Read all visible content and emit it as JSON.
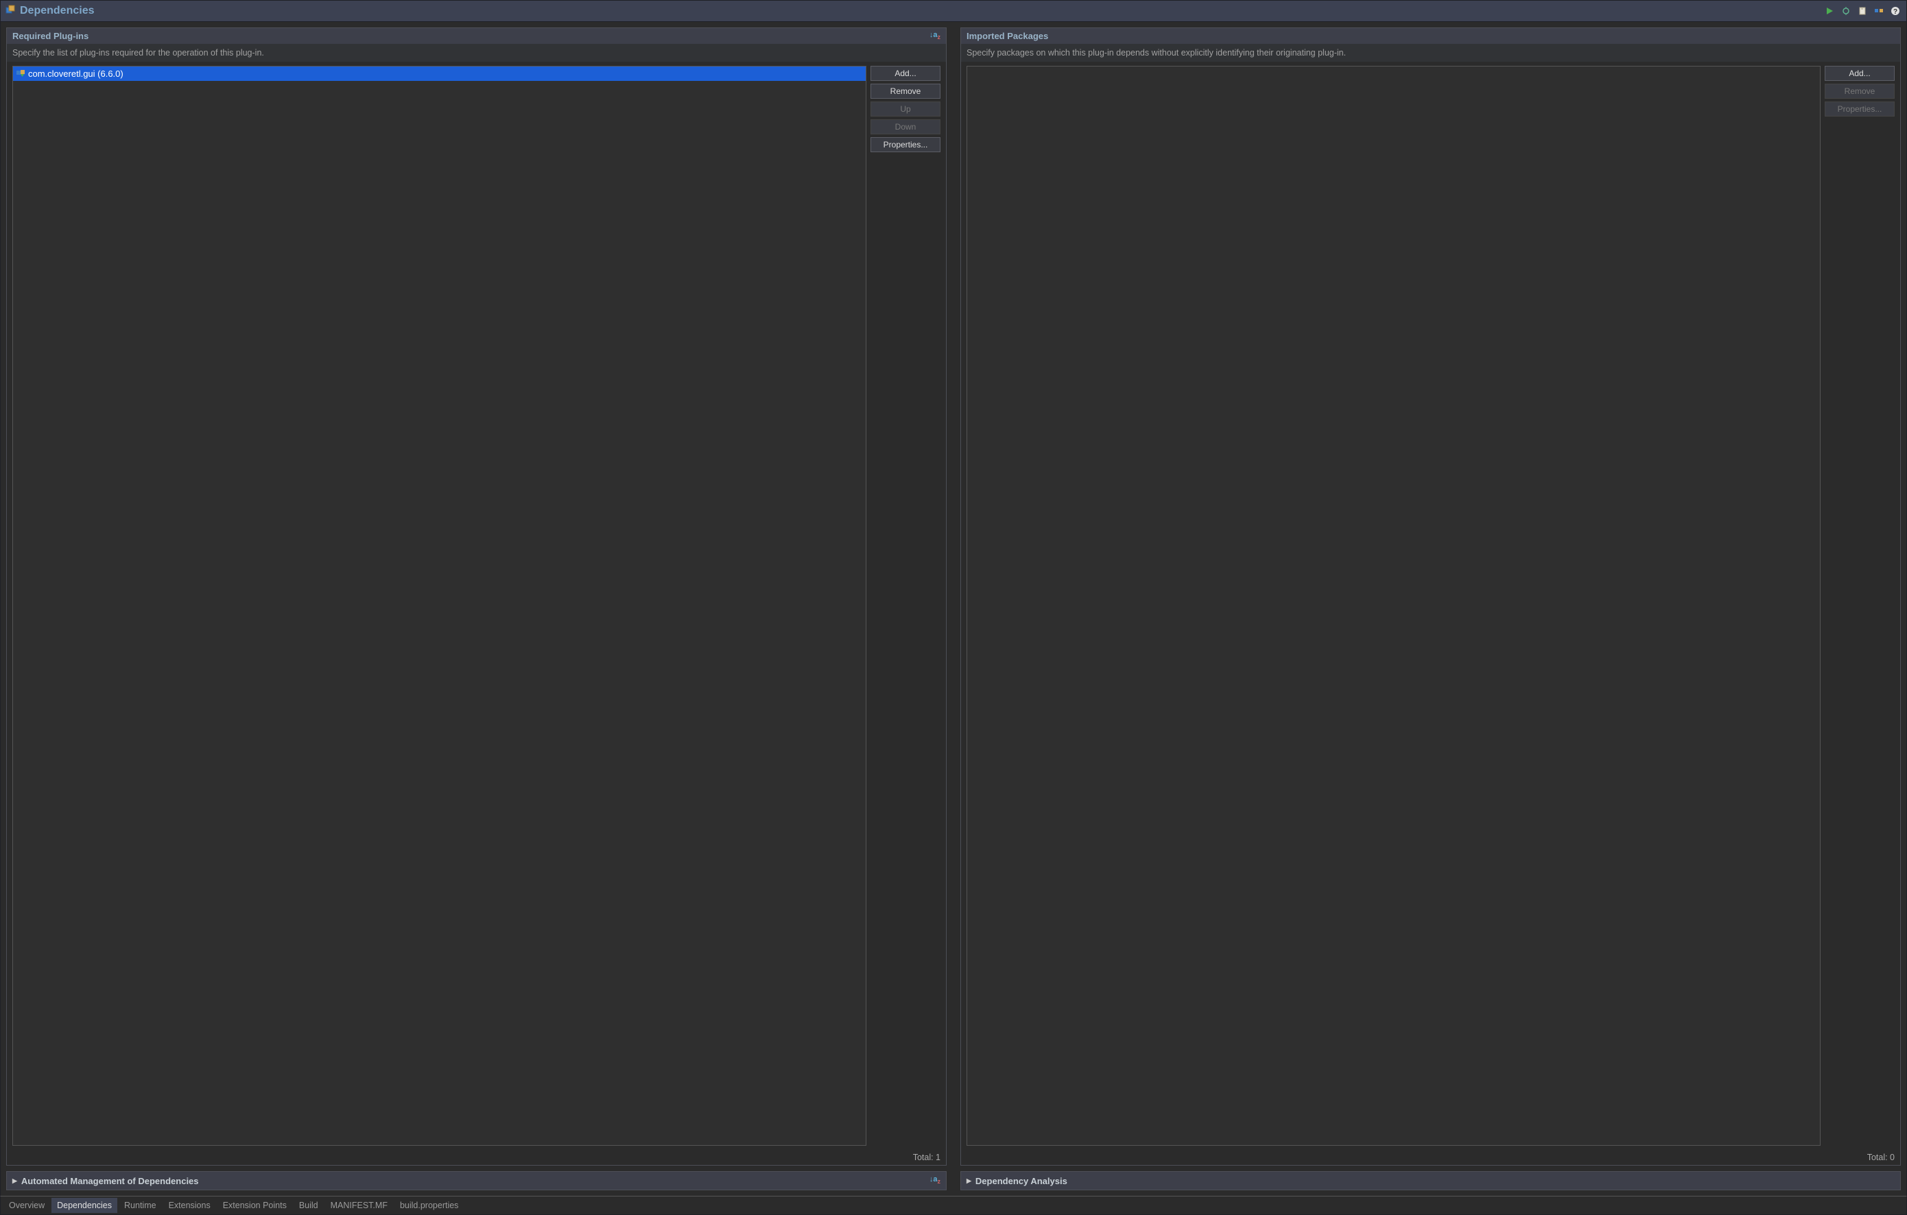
{
  "header": {
    "title": "Dependencies"
  },
  "required": {
    "title": "Required Plug-ins",
    "desc": "Specify the list of plug-ins required for the operation of this plug-in.",
    "items": [
      {
        "label": "com.cloveretl.gui (6.6.0)",
        "selected": true
      }
    ],
    "total_label": "Total: 1",
    "buttons": {
      "add": "Add...",
      "remove": "Remove",
      "up": "Up",
      "down": "Down",
      "properties": "Properties..."
    }
  },
  "imported": {
    "title": "Imported Packages",
    "desc": "Specify packages on which this plug-in depends without explicitly identifying their originating plug-in.",
    "items": [],
    "total_label": "Total: 0",
    "buttons": {
      "add": "Add...",
      "remove": "Remove",
      "properties": "Properties..."
    }
  },
  "expanders": {
    "auto_manage": "Automated Management of Dependencies",
    "analysis": "Dependency Analysis"
  },
  "tabs": [
    {
      "label": "Overview",
      "active": false
    },
    {
      "label": "Dependencies",
      "active": true
    },
    {
      "label": "Runtime",
      "active": false
    },
    {
      "label": "Extensions",
      "active": false
    },
    {
      "label": "Extension Points",
      "active": false
    },
    {
      "label": "Build",
      "active": false
    },
    {
      "label": "MANIFEST.MF",
      "active": false
    },
    {
      "label": "build.properties",
      "active": false
    }
  ]
}
